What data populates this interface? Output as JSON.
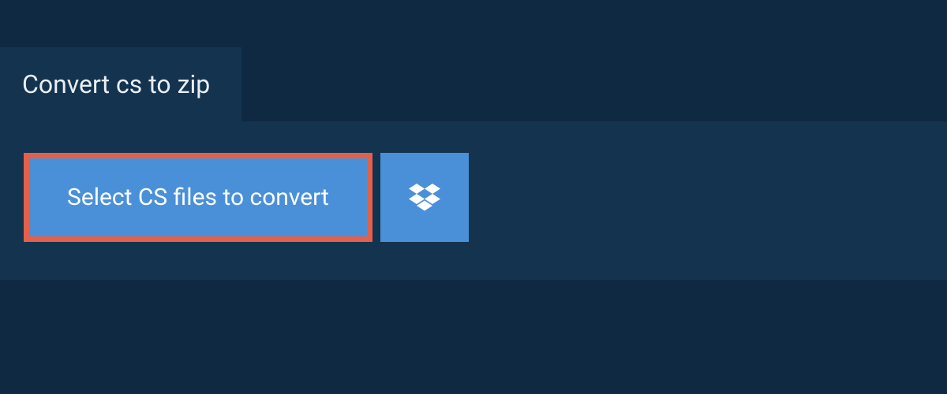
{
  "tab": {
    "title": "Convert cs to zip"
  },
  "actions": {
    "select_label": "Select CS files to convert"
  }
}
